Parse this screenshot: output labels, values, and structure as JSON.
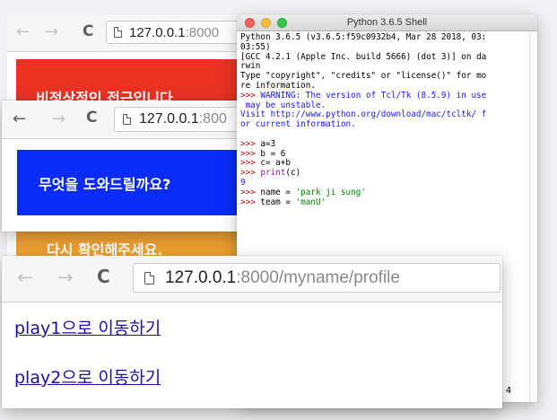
{
  "browser_back": {
    "nav": {
      "back": "←",
      "forward": "→",
      "reload": "C"
    },
    "url_host": "127.0.0.1",
    "url_path": ":8000"
  },
  "browser_middle": {
    "nav": {
      "back": "←",
      "forward": "→",
      "reload": "C"
    },
    "url_host": "127.0.0.1",
    "url_path": ":800"
  },
  "browser_front": {
    "nav": {
      "back": "←",
      "forward": "→",
      "reload": "C"
    },
    "url_host": "127.0.0.1",
    "url_path": ":8000/myname/profile",
    "links": [
      "play1으로 이동하기",
      "play2으로 이동하기"
    ]
  },
  "banners": {
    "red": "비정상적인 접근입니다.",
    "blue": "무엇을 도와드릴까요?",
    "orange": "다시 확인해주세요."
  },
  "colors": {
    "red": "#ea3223",
    "blue": "#0a2bf5",
    "orange": "#f0a232",
    "link": "#1a0dab"
  },
  "shell": {
    "title": "Python 3.6.5 Shell",
    "lines": [
      {
        "t": "Python 3.6.5 (v3.6.5:f59c0932b4, Mar 28 2018, 03:",
        "c": ""
      },
      {
        "t": "03:55)",
        "c": ""
      },
      {
        "t": "[GCC 4.2.1 (Apple Inc. build 5666) (dot 3)] on da",
        "c": ""
      },
      {
        "t": "rwin",
        "c": ""
      },
      {
        "t": "Type \"copyright\", \"credits\" or \"license()\" for mo",
        "c": ""
      },
      {
        "t": "re information.",
        "c": ""
      },
      {
        "segs": [
          {
            "t": ">>> ",
            "c": "red"
          },
          {
            "t": "WARNING: The version of Tcl/Tk (8.5.9) in use",
            "c": "blue"
          }
        ]
      },
      {
        "t": " may be unstable.",
        "c": "blue"
      },
      {
        "t": "Visit http://www.python.org/download/mac/tcltk/ f",
        "c": "blue"
      },
      {
        "t": "or current information.",
        "c": "blue"
      },
      {
        "t": "",
        "c": ""
      },
      {
        "segs": [
          {
            "t": ">>> ",
            "c": "red"
          },
          {
            "t": "a=3",
            "c": ""
          }
        ]
      },
      {
        "segs": [
          {
            "t": ">>> ",
            "c": "red"
          },
          {
            "t": "b = 6",
            "c": ""
          }
        ]
      },
      {
        "segs": [
          {
            "t": ">>> ",
            "c": "red"
          },
          {
            "t": "c= a+b",
            "c": ""
          }
        ]
      },
      {
        "segs": [
          {
            "t": ">>> ",
            "c": "red"
          },
          {
            "t": "print",
            "c": "purple"
          },
          {
            "t": "(c)",
            "c": ""
          }
        ]
      },
      {
        "t": "9",
        "c": "blue"
      },
      {
        "segs": [
          {
            "t": ">>> ",
            "c": "red"
          },
          {
            "t": "name = ",
            "c": ""
          },
          {
            "t": "'park ji sung'",
            "c": "green"
          }
        ]
      },
      {
        "segs": [
          {
            "t": ">>> ",
            "c": "red"
          },
          {
            "t": "team = ",
            "c": ""
          },
          {
            "t": "'manU'",
            "c": "green"
          }
        ]
      }
    ],
    "status": "4"
  }
}
